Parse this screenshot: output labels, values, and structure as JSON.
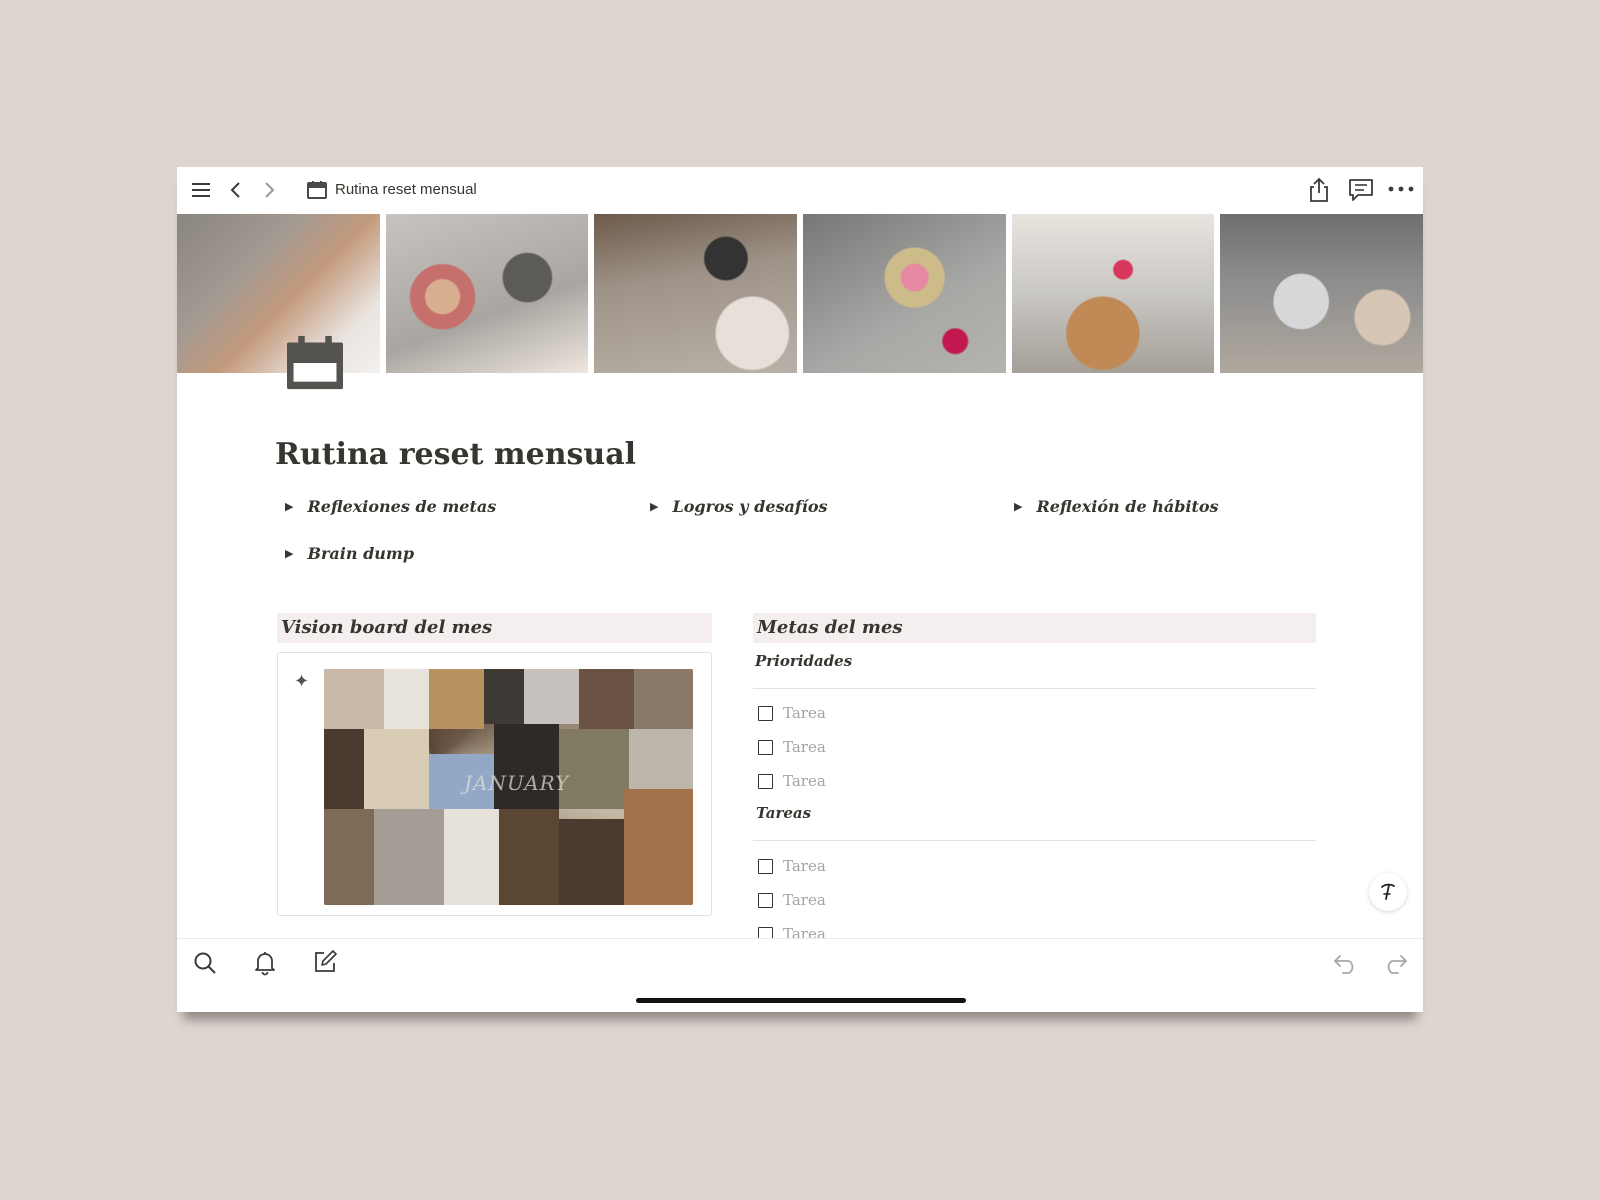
{
  "header": {
    "page_title": "Rutina reset mensual"
  },
  "page": {
    "title": "Rutina reset mensual",
    "toggles": [
      {
        "label": "Reflexiones de metas"
      },
      {
        "label": "Logros y desafíos"
      },
      {
        "label": "Reflexión de hábitos"
      },
      {
        "label": "Brain dump"
      }
    ],
    "vision": {
      "heading": "Vision board del mes",
      "collage_text": "JANUARY"
    },
    "goals": {
      "heading": "Metas del mes",
      "priorities_label": "Prioridades",
      "priorities": [
        "Tarea",
        "Tarea",
        "Tarea"
      ],
      "tasks_label": "Tareas",
      "tasks": [
        "Tarea",
        "Tarea",
        "Tarea"
      ]
    }
  },
  "icons": {
    "menu": "menu-icon",
    "back": "chevron-left-icon",
    "forward": "chevron-right-icon",
    "page": "calendar-icon",
    "share": "share-icon",
    "comments": "comment-icon",
    "more": "more-icon",
    "search": "search-icon",
    "notifications": "bell-icon",
    "new_page": "compose-icon",
    "undo": "undo-icon",
    "redo": "redo-icon",
    "ai": "notion-ai-icon",
    "sparkle": "sparkle-icon"
  },
  "colors": {
    "background": "#ded5d0",
    "text": "#37352f",
    "section_bg": "#f4efee",
    "placeholder": "#a6a39e"
  }
}
